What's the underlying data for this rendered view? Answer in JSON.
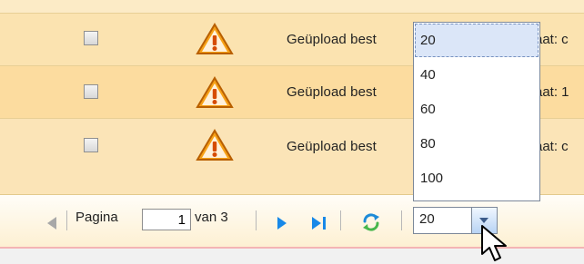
{
  "grid": {
    "rows": [
      {
        "text": "Geüpload best",
        "text_end": "aat: c",
        "icon": "warning-icon"
      },
      {
        "text": "Geüpload best",
        "text_end": "aat: 1",
        "icon": "warning-icon"
      },
      {
        "text": "Geüpload best",
        "text_end": "aat: c",
        "icon": "warning-icon"
      }
    ]
  },
  "pager": {
    "page_label": "Pagina",
    "current_page": "1",
    "total_label": "van 3",
    "page_size": "20",
    "icons": {
      "previous": "previous-icon",
      "next": "next-icon",
      "last": "last-page-icon",
      "refresh": "refresh-icon",
      "dropdown": "chevron-down-icon"
    }
  },
  "dropdown": {
    "options": [
      "20",
      "40",
      "60",
      "80",
      "100"
    ],
    "selected": "20"
  },
  "colors": {
    "row_background": "#fbe3b0",
    "row_background_alt": "#fcdc9f",
    "warning_fill": "#f28b10",
    "pager_blue": "#1788e8",
    "dropdown_highlight": "#dbe6f8"
  }
}
